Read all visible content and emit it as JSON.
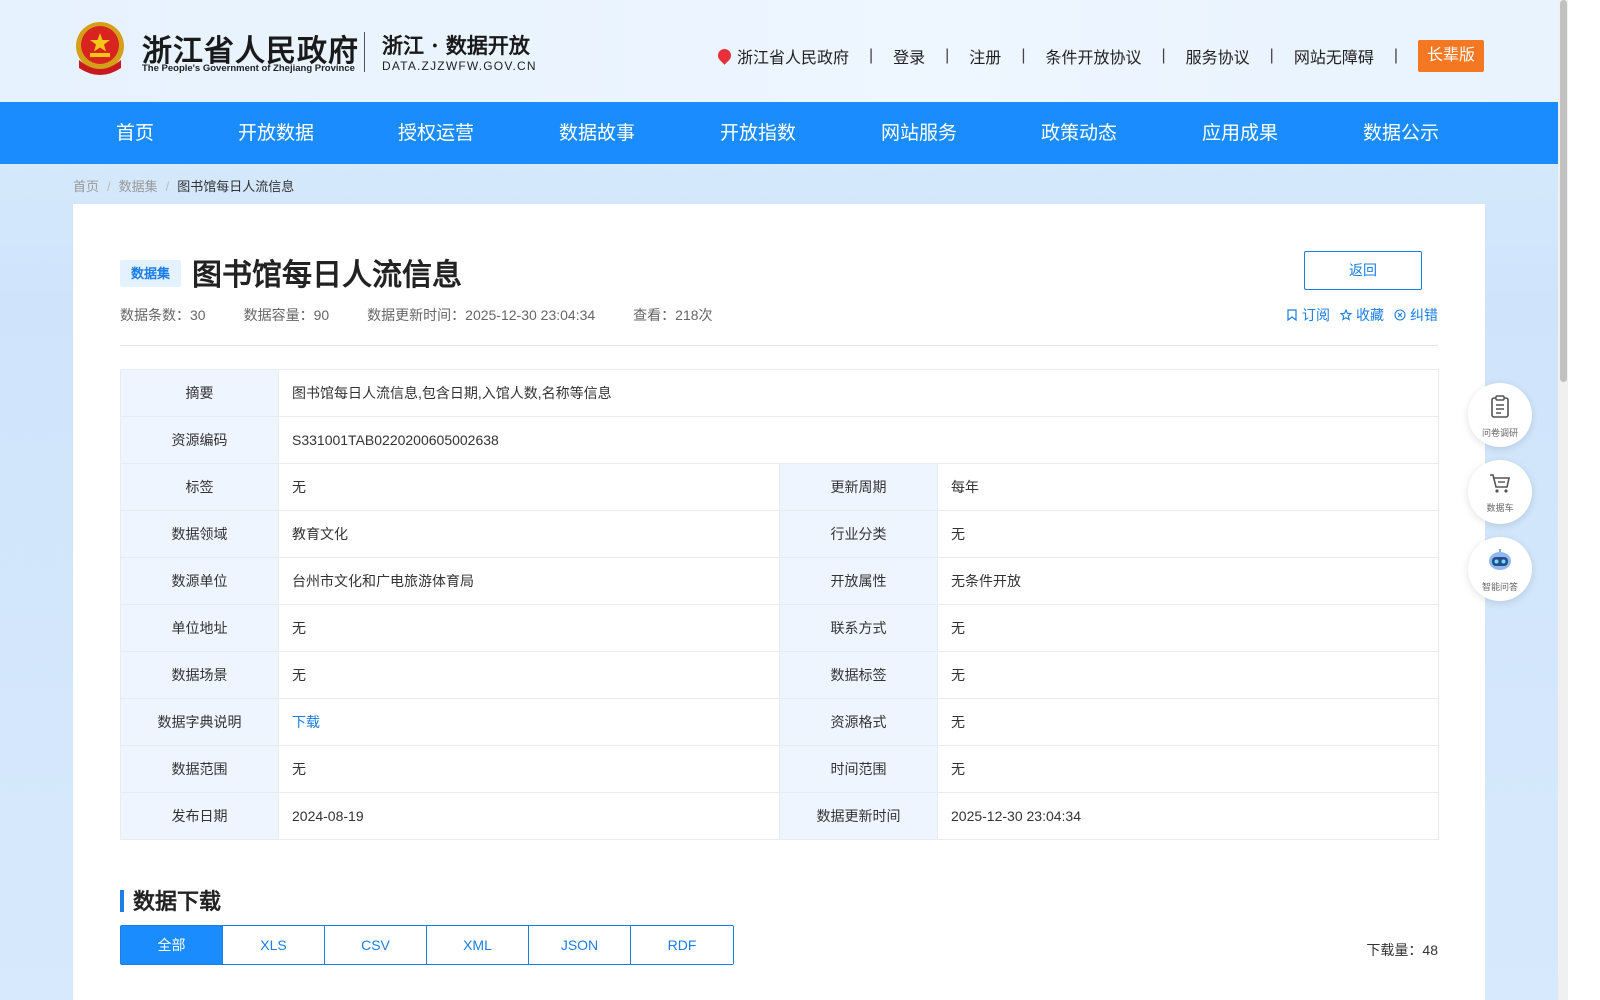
{
  "header": {
    "gov_name_cn": "浙江省人民政府",
    "gov_name_en": "The People's Government of Zhejiang Province",
    "site_name_cn": "浙江 · 数据开放",
    "site_domain": "DATA.ZJZWFW.GOV.CN",
    "links": [
      "浙江省人民政府",
      "登录",
      "注册",
      "条件开放协议",
      "服务协议",
      "网站无障碍"
    ],
    "elder_mode_label": "长辈版",
    "accent_color": "#f47722"
  },
  "nav": {
    "color": "#1a8cfe",
    "items": [
      "首页",
      "开放数据",
      "授权运营",
      "数据故事",
      "开放指数",
      "网站服务",
      "政策动态",
      "应用成果",
      "数据公示"
    ]
  },
  "breadcrumb": {
    "items": [
      "首页",
      "数据集",
      "图书馆每日人流信息"
    ],
    "separator": "/"
  },
  "dataset": {
    "tag": "数据集",
    "title": "图书馆每日人流信息",
    "back_label": "返回",
    "meta": {
      "count_label": "数据条数：",
      "count": "30",
      "capacity_label": "数据容量：",
      "capacity": "90",
      "updated_label": "数据更新时间：",
      "updated": "2025-12-30 23:04:34",
      "views_label": "查看：",
      "views": "218次"
    },
    "actions": {
      "subscribe": "订阅",
      "favorite": "收藏",
      "report": "纠错"
    }
  },
  "info": {
    "summary_label": "摘要",
    "summary": "图书馆每日人流信息,包含日期,入馆人数,名称等信息",
    "code_label": "资源编码",
    "code": "S331001TAB0220200605002638",
    "rows": [
      {
        "l1": "标签",
        "v1": "无",
        "l2": "更新周期",
        "v2": "每年"
      },
      {
        "l1": "数据领域",
        "v1": "教育文化",
        "l2": "行业分类",
        "v2": "无"
      },
      {
        "l1": "数源单位",
        "v1": "台州市文化和广电旅游体育局",
        "l2": "开放属性",
        "v2": "无条件开放"
      },
      {
        "l1": "单位地址",
        "v1": "无",
        "l2": "联系方式",
        "v2": "无"
      },
      {
        "l1": "数据场景",
        "v1": "无",
        "l2": "数据标签",
        "v2": "无"
      },
      {
        "l1": "数据字典说明",
        "v1": "下载",
        "l2": "资源格式",
        "v2": "无"
      },
      {
        "l1": "数据范围",
        "v1": "无",
        "l2": "时间范围",
        "v2": "无"
      },
      {
        "l1": "发布日期",
        "v1": "2024-08-19",
        "l2": "数据更新时间",
        "v2": "2025-12-30 23:04:34"
      }
    ]
  },
  "download": {
    "title": "数据下载",
    "tabs": [
      "全部",
      "XLS",
      "CSV",
      "XML",
      "JSON",
      "RDF"
    ],
    "active_tab": "全部",
    "count_label": "下载量：",
    "count": "48"
  },
  "float_tools": [
    {
      "label": "问卷调研",
      "icon": "clipboard-icon"
    },
    {
      "label": "数据车",
      "icon": "cart-icon"
    },
    {
      "label": "智能问答",
      "icon": "robot-icon"
    }
  ]
}
